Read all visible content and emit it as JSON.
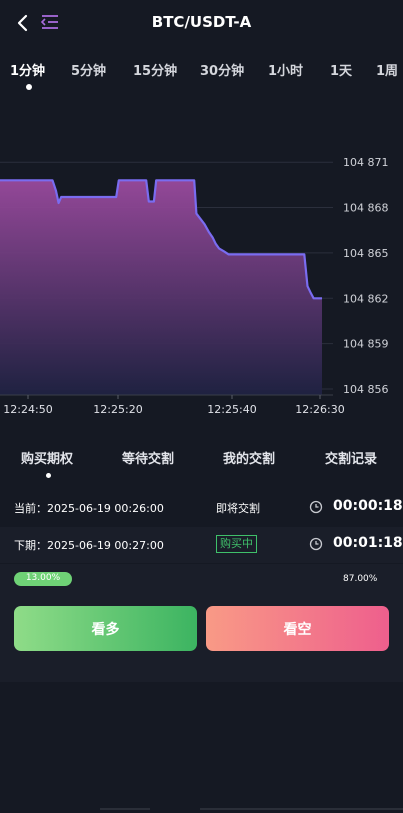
{
  "header": {
    "title": "BTC/USDT-A"
  },
  "timeframes": [
    "1分钟",
    "5分钟",
    "15分钟",
    "30分钟",
    "1小时",
    "1天",
    "1周"
  ],
  "chart_data": {
    "type": "area",
    "title": "",
    "xlabel": "",
    "ylabel": "",
    "x_ticks": [
      "12:24:50",
      "12:25:20",
      "12:25:40",
      "12:26:30"
    ],
    "y_ticks": [
      104871,
      104868,
      104865,
      104862,
      104859,
      104856
    ],
    "y_tick_labels": [
      "104 871",
      "104 868",
      "104 865",
      "104 862",
      "104 859",
      "104 856"
    ],
    "ylim": [
      104855.6,
      104872.8
    ],
    "grid": true,
    "series": [
      {
        "values": [
          [
            0.0,
            104869.8
          ],
          [
            0.163,
            104869.8
          ],
          [
            0.174,
            104869.1
          ],
          [
            0.182,
            104868.3
          ],
          [
            0.19,
            104868.7
          ],
          [
            0.195,
            104868.7
          ],
          [
            0.361,
            104868.7
          ],
          [
            0.369,
            104869.8
          ],
          [
            0.454,
            104869.8
          ],
          [
            0.462,
            104868.4
          ],
          [
            0.478,
            104868.4
          ],
          [
            0.485,
            104869.8
          ],
          [
            0.603,
            104869.8
          ],
          [
            0.61,
            104867.6
          ],
          [
            0.635,
            104866.9
          ],
          [
            0.648,
            104866.4
          ],
          [
            0.661,
            104866.0
          ],
          [
            0.67,
            104865.6
          ],
          [
            0.68,
            104865.3
          ],
          [
            0.696,
            104865.1
          ],
          [
            0.71,
            104864.9
          ],
          [
            0.945,
            104864.9
          ],
          [
            0.955,
            104862.8
          ],
          [
            0.964,
            104862.4
          ],
          [
            0.974,
            104862.0
          ],
          [
            1.0,
            104862.0
          ]
        ]
      }
    ],
    "colors": {
      "line": "#7a6cf0",
      "fill_top": "#9a4a9e",
      "fill_bottom": "#1f2242",
      "grid": "#2b2f3c",
      "axis": "#3a3e4a"
    }
  },
  "tabs": [
    "购买期权",
    "等待交割",
    "我的交割",
    "交割记录"
  ],
  "rounds": {
    "current": {
      "label": "当前：2025-06-19 00:26:00",
      "status": "即将交割",
      "countdown": "00:00:18"
    },
    "next": {
      "label": "下期：2025-06-19 00:27:00",
      "status": "购买中",
      "countdown": "00:01:18"
    }
  },
  "ratio": {
    "up_pct": 13,
    "up_label": "13.00%",
    "down_label": "87.00%"
  },
  "buttons": {
    "up": "看多",
    "down": "看空"
  },
  "icons": {
    "back": "chevron-left-icon",
    "menu": "menu-list-icon",
    "clock": "clock-icon"
  }
}
